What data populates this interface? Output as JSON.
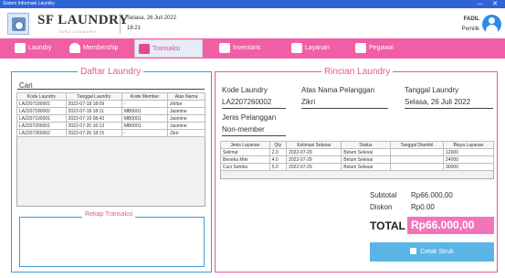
{
  "window": {
    "title": "Sistem Informasi Laundry",
    "controls": "— ✕"
  },
  "header": {
    "app_name": "SF LAUNDRY",
    "app_subtitle": "JASA LAUNDRY",
    "date": "Selasa, 26 Juli 2022",
    "time": "18:21",
    "user_name": "FADIL",
    "user_role": "Pemilik"
  },
  "nav": {
    "items": [
      {
        "label": "Laundry",
        "icon": "laundry-icon"
      },
      {
        "label": "Membership",
        "icon": "person-icon"
      },
      {
        "label": "Transaksi",
        "icon": "transaction-icon",
        "active": true
      },
      {
        "label": "Inventaris",
        "icon": "inventory-icon"
      },
      {
        "label": "Layanan",
        "icon": "service-icon"
      },
      {
        "label": "Pegawai",
        "icon": "employee-icon"
      }
    ]
  },
  "daftar": {
    "title": "Daftar Laundry",
    "search_label": "Cari",
    "columns": [
      "Kode Laundry",
      "Tanggal Laundry",
      "Kode Member",
      "Atas Nama"
    ],
    "rows": [
      [
        "LA2207180001",
        "2022-07-18 18:09",
        "-",
        "zhifan"
      ],
      [
        "LA2207180002",
        "2022-07-18 18:11",
        "MB0001",
        "Jasmine"
      ],
      [
        "LA2207190001",
        "2022-07-19 08:43",
        "MB0001",
        "Jasmine"
      ],
      [
        "LA2207200001",
        "2022-07-20 16:13",
        "MB0001",
        "Jasmine"
      ],
      [
        "LA2207260002",
        "2022-07-26 18:15",
        "-",
        "Zikri"
      ]
    ]
  },
  "rekap": {
    "title": "Rekap Transaksi"
  },
  "rincian": {
    "title": "Rincian Laundry",
    "kode_label": "Kode Laundry",
    "kode_value": "LA2207260002",
    "nama_label": "Atas Nama Pelanggan",
    "nama_value": "Zikri",
    "tanggal_label": "Tanggal Laundry",
    "tanggal_value": "Selasa, 26 Juli 2022",
    "jenis_label": "Jenis Pelanggan",
    "jenis_value": "Non-member",
    "columns": [
      "Jenis Layanan",
      "Qty",
      "Estimasi Selesai",
      "Status",
      "Tanggal Diambil",
      "Biaya Layanan"
    ],
    "rows": [
      [
        "Selimut",
        "2.0",
        "2022-07-29",
        "Belum Selesai",
        "",
        "12000"
      ],
      [
        "Beneka Mini",
        "4.0",
        "2022-07-29",
        "Belum Selesai",
        "",
        "24000"
      ],
      [
        "Cuci Setrika",
        "5.0",
        "2022-07-29",
        "Belum Selesai",
        "",
        "30000"
      ]
    ],
    "subtotal_label": "Subtotal",
    "subtotal_value": "Rp66.000,00",
    "diskon_label": "Diskon",
    "diskon_value": "Rp0.00",
    "total_label": "TOTAL",
    "total_value": "Rp66.000,00",
    "print_label": "Cetak Struk"
  },
  "colors": {
    "accent_pink": "#f05fa6",
    "accent_blue": "#2f63d8",
    "panel_border": "#3e9ad6"
  }
}
